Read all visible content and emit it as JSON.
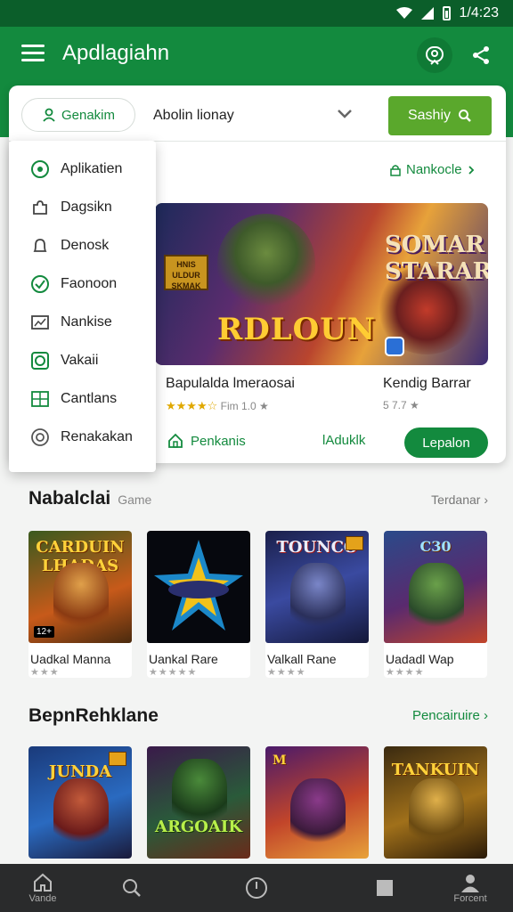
{
  "status_bar": {
    "time": "1/4:23"
  },
  "app_bar": {
    "title": "Apdlagiahn"
  },
  "search": {
    "genre_label": "Genakim",
    "query": "Abolin lionay",
    "button_label": "Sashiy"
  },
  "dropdown": {
    "items": [
      {
        "label": "Aplikatien",
        "icon": "target-icon"
      },
      {
        "label": "Dagsikn",
        "icon": "puzzle-icon"
      },
      {
        "label": "Denosk",
        "icon": "bell-icon"
      },
      {
        "label": "Faonoon",
        "icon": "check-circle-icon"
      },
      {
        "label": "Nankise",
        "icon": "chart-icon"
      },
      {
        "label": "Vakaii",
        "icon": "square-target-icon"
      },
      {
        "label": "Cantlans",
        "icon": "grid-icon"
      },
      {
        "label": "Renakakan",
        "icon": "radio-icon"
      }
    ]
  },
  "featured": {
    "link": "Nankocle",
    "banner_title": "RDLOUN",
    "banner_title2": "SOMAR STARAR",
    "banner_tag": "HNIS ULDUR SKMAK",
    "game1_name": "Bapulalda lmeraosai",
    "game1_rating_stars": "★★★★☆",
    "game1_rating_text": "Fim 1.0 ★",
    "game2_name": "Kendig Barrar",
    "game2_rating_text": "5 7.7 ★",
    "action1_label": "Penkanis",
    "action2_label": "lAduklk",
    "install_label": "Lepalon"
  },
  "section1": {
    "title": "Nabalclai",
    "subtitle": "Game",
    "link": "Terdanar",
    "tiles": [
      {
        "name": "Uadkal Manna",
        "rating": "★★★",
        "art": "CARDUIN LHADAS"
      },
      {
        "name": "Uankal Rare",
        "rating": "★★★★★",
        "art": ""
      },
      {
        "name": "Valkall Rane",
        "rating": "★★★★",
        "art": "TOUNCO"
      },
      {
        "name": "Uadadl Wap",
        "rating": "★★★★",
        "art": "C30"
      }
    ]
  },
  "section2": {
    "title": "BepnRehklane",
    "link": "Pencairuire",
    "tiles": [
      {
        "art": "JUNDA"
      },
      {
        "art": "ARGOAIK"
      },
      {
        "art": "M"
      },
      {
        "art": "TANKUIN"
      }
    ]
  },
  "bottom_nav": {
    "items": [
      {
        "label": "Vande",
        "icon": "home-icon"
      },
      {
        "label": "",
        "icon": "search-icon"
      },
      {
        "label": "",
        "icon": "compass-icon"
      },
      {
        "label": "",
        "icon": "square-icon"
      },
      {
        "label": "Forcent",
        "icon": "person-icon"
      }
    ]
  },
  "colors": {
    "primary": "#138a3e",
    "primary_dark": "#0b5e2a",
    "search_button": "#5aa82c"
  }
}
